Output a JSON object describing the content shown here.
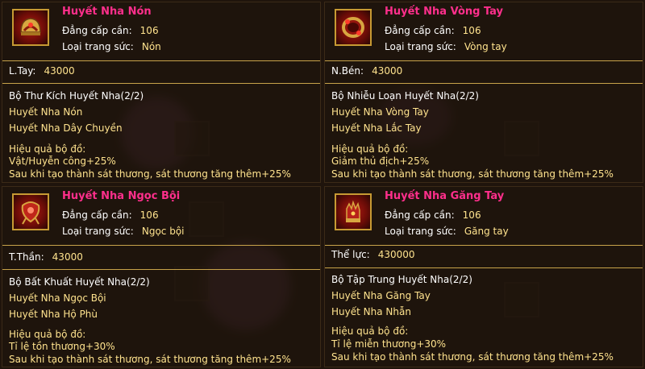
{
  "panels": [
    {
      "name": "Huyết Nha Nón",
      "level_label": "Đẳng cấp cần:",
      "level_value": "106",
      "type_label": "Loại trang sức:",
      "type_value": "Nón",
      "stat_label": "L.Tay:",
      "stat_value": "43000",
      "set_title": "Bộ Thư Kích Huyết Nha(2/2)",
      "set_items": [
        "Huyết Nha Nón",
        "Huyết Nha Dây Chuyền"
      ],
      "effect_header": "Hiệu quả bộ đồ:",
      "effects": [
        "Vật/Huyễn công+25%",
        "Sau khi tạo thành sát thương, sát thương tăng thêm+25%"
      ],
      "icon": "helmet-icon"
    },
    {
      "name": "Huyết Nha Vòng Tay",
      "level_label": "Đẳng cấp cần:",
      "level_value": "106",
      "type_label": "Loại trang sức:",
      "type_value": "Vòng tay",
      "stat_label": "N.Bén:",
      "stat_value": "43000",
      "set_title": "Bộ Nhiễu Loạn Huyết Nha(2/2)",
      "set_items": [
        "Huyết Nha Vòng Tay",
        "Huyết Nha Lắc Tay"
      ],
      "effect_header": "Hiệu quả bộ đồ:",
      "effects": [
        "Giảm thủ địch+25%",
        "Sau khi tạo thành sát thương, sát thương tăng thêm+25%"
      ],
      "icon": "bracelet-icon"
    },
    {
      "name": "Huyết Nha Ngọc Bội",
      "level_label": "Đẳng cấp cần:",
      "level_value": "106",
      "type_label": "Loại trang sức:",
      "type_value": "Ngọc bội",
      "stat_label": "T.Thần:",
      "stat_value": "43000",
      "set_title": "Bộ Bất Khuất Huyết Nha(2/2)",
      "set_items": [
        "Huyết Nha Ngọc Bội",
        "Huyết Nha Hộ Phù"
      ],
      "effect_header": "Hiệu quả bộ đồ:",
      "effects": [
        "Tỉ lệ tồn thương+30%",
        "Sau khi tạo thành sát thương, sát thương tăng thêm+25%"
      ],
      "icon": "jade-pendant-icon"
    },
    {
      "name": "Huyết Nha Găng Tay",
      "level_label": "Đẳng cấp cần:",
      "level_value": "106",
      "type_label": "Loại trang sức:",
      "type_value": "Găng tay",
      "stat_label": "Thể lực:",
      "stat_value": "430000",
      "set_title": "Bộ Tập Trung Huyết Nha(2/2)",
      "set_items": [
        "Huyết Nha Găng Tay",
        "Huyết Nha Nhẫn"
      ],
      "effect_header": "Hiệu quả bộ đồ:",
      "effects": [
        "Tỉ lệ miễn thương+30%",
        "Sau khi tạo thành sát thương, sát thương tăng thêm+25%"
      ],
      "icon": "glove-icon"
    }
  ],
  "colors": {
    "item_name": "#ff2f8c",
    "value": "#ffe38e",
    "label": "#ffffff",
    "separator": "#c8a34a"
  }
}
